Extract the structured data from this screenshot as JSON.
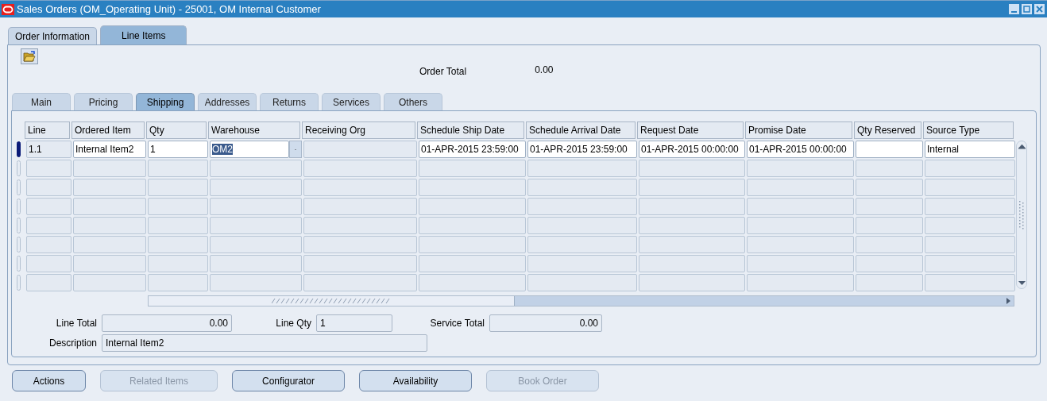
{
  "window": {
    "title": "Sales Orders (OM_Operating Unit) - 25001, OM Internal Customer"
  },
  "tabs": [
    {
      "label": "Order Information",
      "selected": false
    },
    {
      "label": "Line Items",
      "selected": true
    }
  ],
  "order_total": {
    "label": "Order Total",
    "value": "0.00"
  },
  "subtabs": [
    {
      "label": "Main",
      "selected": false
    },
    {
      "label": "Pricing",
      "selected": false
    },
    {
      "label": "Shipping",
      "selected": true
    },
    {
      "label": "Addresses",
      "selected": false
    },
    {
      "label": "Returns",
      "selected": false
    },
    {
      "label": "Services",
      "selected": false
    },
    {
      "label": "Others",
      "selected": false
    }
  ],
  "table": {
    "columns": [
      "Line",
      "Ordered Item",
      "Qty",
      "Warehouse",
      "Receiving Org",
      "Schedule Ship Date",
      "Schedule Arrival Date",
      "Request Date",
      "Promise Date",
      "Qty Reserved",
      "Source Type"
    ],
    "rows": [
      {
        "current": true,
        "cells": [
          {
            "value": "1.1",
            "editable": false
          },
          {
            "value": "Internal Item2",
            "editable": true
          },
          {
            "value": "1",
            "editable": true
          },
          {
            "value": "OM2",
            "editable": true,
            "selected": true,
            "lov": true
          },
          {
            "editable": false
          },
          {
            "value": "01-APR-2015 23:59:00",
            "editable": true
          },
          {
            "value": "01-APR-2015 23:59:00",
            "editable": true
          },
          {
            "value": "01-APR-2015 00:00:00",
            "editable": true
          },
          {
            "value": "01-APR-2015 00:00:00",
            "editable": true
          },
          {
            "editable": true
          },
          {
            "value": "Internal",
            "editable": true
          }
        ]
      }
    ]
  },
  "totals": [
    {
      "label": "Line Total",
      "value": "0.00",
      "kind": "amount"
    },
    {
      "label": "Line Qty",
      "value": "1",
      "kind": "count"
    },
    {
      "label": "Service Total",
      "value": "0.00",
      "kind": "amount"
    }
  ],
  "description": {
    "label": "Description",
    "value": "Internal Item2"
  },
  "buttons": [
    {
      "label": "Actions",
      "disabled": false
    },
    {
      "label": "Related Items",
      "disabled": true
    },
    {
      "label": "Configurator",
      "disabled": false
    },
    {
      "label": "Availability",
      "disabled": false
    },
    {
      "label": "Book Order",
      "disabled": true
    }
  ]
}
